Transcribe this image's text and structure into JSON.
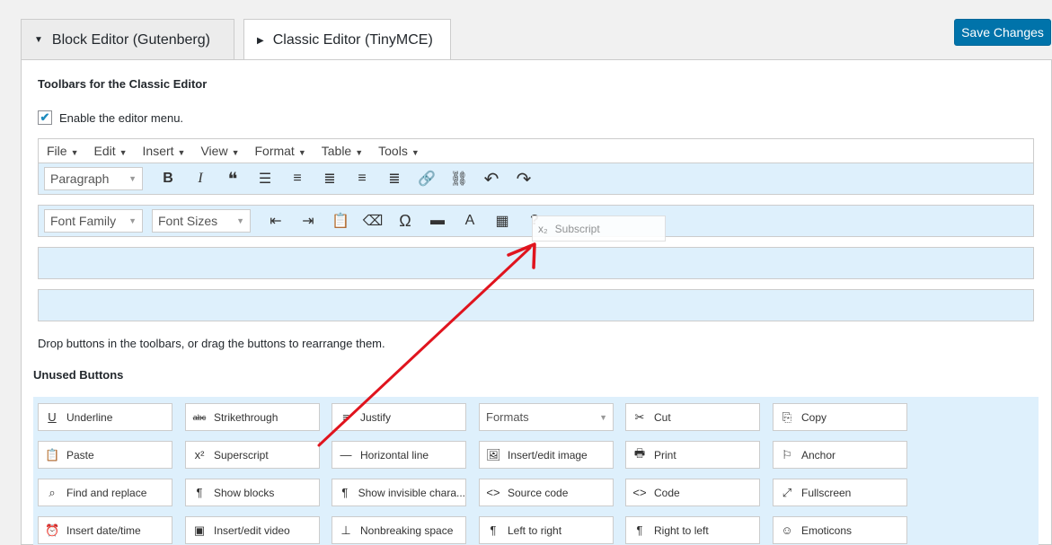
{
  "tabs": [
    {
      "label": "Block Editor (Gutenberg)",
      "arrow": "▼"
    },
    {
      "label": "Classic Editor (TinyMCE)",
      "arrow": "▶"
    }
  ],
  "save_button": "Save Changes",
  "section_title": "Toolbars for the Classic Editor",
  "enable_menu": {
    "label": "Enable the editor menu.",
    "checked": true
  },
  "menubar": [
    "File",
    "Edit",
    "Insert",
    "View",
    "Format",
    "Table",
    "Tools"
  ],
  "toolbar1": {
    "select": "Paragraph",
    "icons": [
      "B",
      "I",
      "❝",
      "☰",
      "≡",
      "≣",
      "≡",
      "≣",
      "🔗",
      "⛓",
      "↶",
      "↷"
    ]
  },
  "toolbar2": {
    "selects": [
      "Font Family",
      "Font Sizes"
    ],
    "icons": [
      "⇤",
      "⇥",
      "📋",
      "⌫",
      "Ω",
      "▬",
      "A",
      "▦",
      "?"
    ]
  },
  "drag_ghost": {
    "icon": "x₂",
    "label": "Subscript"
  },
  "hint": "Drop buttons in the toolbars, or drag the buttons to rearrange them.",
  "unused_title": "Unused Buttons",
  "unused_buttons": [
    {
      "icon": "U",
      "label": "Underline"
    },
    {
      "icon": "abc",
      "label": "Strikethrough"
    },
    {
      "icon": "≡",
      "label": "Justify"
    },
    {
      "icon": "",
      "label": "Formats"
    },
    {
      "icon": "✂",
      "label": "Cut"
    },
    {
      "icon": "⎘",
      "label": "Copy"
    },
    {
      "icon": "📋",
      "label": "Paste"
    },
    {
      "icon": "x²",
      "label": "Superscript"
    },
    {
      "icon": "—",
      "label": "Horizontal line"
    },
    {
      "icon": "🖼",
      "label": "Insert/edit image"
    },
    {
      "icon": "🖶",
      "label": "Print"
    },
    {
      "icon": "⚐",
      "label": "Anchor"
    },
    {
      "icon": "⌕",
      "label": "Find and replace"
    },
    {
      "icon": "¶",
      "label": "Show blocks"
    },
    {
      "icon": "¶",
      "label": "Show invisible chara..."
    },
    {
      "icon": "<>",
      "label": "Source code"
    },
    {
      "icon": "<>",
      "label": "Code"
    },
    {
      "icon": "⤢",
      "label": "Fullscreen"
    },
    {
      "icon": "⏰",
      "label": "Insert date/time"
    },
    {
      "icon": "▣",
      "label": "Insert/edit video"
    },
    {
      "icon": "⊥",
      "label": "Nonbreaking space"
    },
    {
      "icon": "¶",
      "label": "Left to right"
    },
    {
      "icon": "¶",
      "label": "Right to left"
    },
    {
      "icon": "☺",
      "label": "Emoticons"
    }
  ],
  "accent_color": "#0073aa",
  "annotation_color": "#e0141e"
}
